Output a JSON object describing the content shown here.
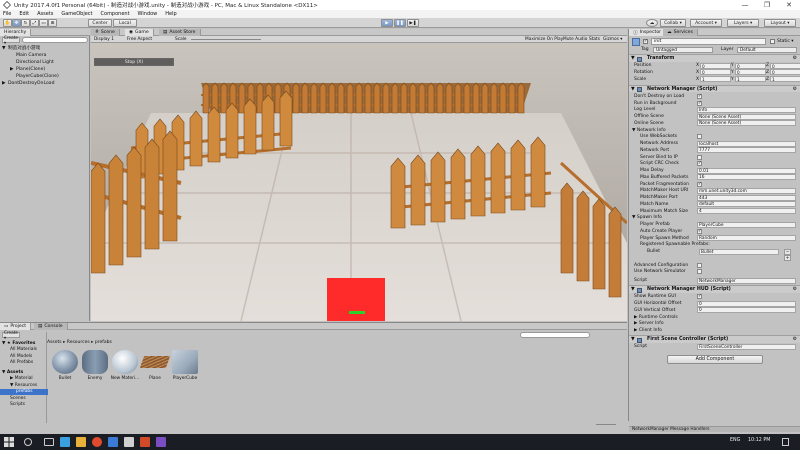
{
  "window": {
    "title": "Unity 2017.4.0f1 Personal (64bit) - 制造对战小游戏.unity - 制造对战小游戏 - PC, Mac & Linux Standalone <DX11>",
    "minimize": "—",
    "maximize": "❐",
    "close": "✕"
  },
  "menubar": [
    "File",
    "Edit",
    "Assets",
    "GameObject",
    "Component",
    "Window",
    "Help"
  ],
  "toolbar": {
    "pivot": "Center",
    "space": "Local",
    "play": "▶",
    "pause": "❚❚",
    "step": "▶❚",
    "collab": "Collab ▾",
    "account": "Account ▾",
    "layers": "Layers ▾",
    "layout": "Layout ▾"
  },
  "hierarchy": {
    "tab": "Hierarchy",
    "create": "Create ▾",
    "items": [
      {
        "label": "制造对战小游戏",
        "indent": 0,
        "arrow": "▼"
      },
      {
        "label": "Main Camera",
        "indent": 1,
        "arrow": ""
      },
      {
        "label": "Directional Light",
        "indent": 1,
        "arrow": ""
      },
      {
        "label": "Plane(Clone)",
        "indent": 1,
        "arrow": "▶"
      },
      {
        "label": "PlayerCube(Clone)",
        "indent": 1,
        "arrow": ""
      },
      {
        "label": "DontDestroyOnLoad",
        "indent": 0,
        "arrow": "▶"
      }
    ]
  },
  "gameview": {
    "tabs": [
      "Scene",
      "Game",
      "Asset Store"
    ],
    "display": "Display 1",
    "aspect": "Free Aspect",
    "scale_label": "Scale",
    "options": [
      "Maximize On Play",
      "Mute Audio",
      "Stats",
      "Gizmos ▾"
    ],
    "hud_button": "Stop (X)"
  },
  "inspector": {
    "tabs": [
      "Inspector",
      "Services"
    ],
    "object_name": "init",
    "static_label": "Static ▾",
    "tag_label": "Tag",
    "tag_value": "Untagged",
    "layer_label": "Layer",
    "layer_value": "Default",
    "transform": {
      "header": "Transform",
      "rows": [
        {
          "label": "Position",
          "x": "0",
          "y": "0",
          "z": "0"
        },
        {
          "label": "Rotation",
          "x": "0",
          "y": "0",
          "z": "0"
        },
        {
          "label": "Scale",
          "x": "1",
          "y": "1",
          "z": "1"
        }
      ]
    },
    "network_manager": {
      "header": "Network Manager (Script)",
      "rows": [
        {
          "label": "Don't Destroy on Load",
          "type": "check",
          "value": "✓"
        },
        {
          "label": "Run in Background",
          "type": "check",
          "value": "✓"
        },
        {
          "label": "Log Level",
          "type": "field",
          "value": "Info"
        },
        {
          "label": "Offline Scene",
          "type": "field",
          "value": "None (Scene Asset)"
        },
        {
          "label": "Online Scene",
          "type": "field",
          "value": "None (Scene Asset)"
        },
        {
          "label": "▼ Network Info",
          "type": "section",
          "value": ""
        },
        {
          "label": "Use WebSockets",
          "type": "check",
          "value": ""
        },
        {
          "label": "Network Address",
          "type": "field",
          "value": "localhost"
        },
        {
          "label": "Network Port",
          "type": "field",
          "value": "7777"
        },
        {
          "label": "Server Bind to IP",
          "type": "check",
          "value": ""
        },
        {
          "label": "Script CRC Check",
          "type": "check",
          "value": "✓"
        },
        {
          "label": "Max Delay",
          "type": "field",
          "value": "0.01"
        },
        {
          "label": "Max Buffered Packets",
          "type": "field",
          "value": "16"
        },
        {
          "label": "Packet Fragmentation",
          "type": "check",
          "value": "✓"
        },
        {
          "label": "MatchMaker Host URI",
          "type": "field",
          "value": "mm.unet.unity3d.com"
        },
        {
          "label": "MatchMaker Port",
          "type": "field",
          "value": "443"
        },
        {
          "label": "Match Name",
          "type": "field",
          "value": "default"
        },
        {
          "label": "Maximum Match Size",
          "type": "field",
          "value": "4"
        },
        {
          "label": "▼ Spawn Info",
          "type": "section",
          "value": ""
        },
        {
          "label": "Player Prefab",
          "type": "field",
          "value": "PlayerCube"
        },
        {
          "label": "Auto Create Player",
          "type": "check",
          "value": "✓"
        },
        {
          "label": "Player Spawn Method",
          "type": "field",
          "value": "Random"
        },
        {
          "label": "Registered Spawnable Prefabs:",
          "type": "plain",
          "value": ""
        }
      ],
      "spawn_list": {
        "label": "Bullet",
        "value": "Bullet"
      },
      "advanced_config": "Advanced Configuration",
      "use_simulator": "Use Network Simulator",
      "script_label": "Script",
      "script_value": "NetworkManager"
    },
    "hud": {
      "header": "Network Manager HUD (Script)",
      "rows": [
        {
          "label": "Show Runtime GUI",
          "type": "check",
          "value": "✓"
        },
        {
          "label": "GUI Horizontal Offset",
          "type": "field",
          "value": "0"
        },
        {
          "label": "GUI Vertical Offset",
          "type": "field",
          "value": "0"
        }
      ],
      "runtime_controls": "▶ Runtime Controls",
      "server_info": "▶ Server Info",
      "client_info": "▶ Client Info"
    },
    "first_scene": {
      "header": "First Scene Controller (Script)",
      "script_label": "Script",
      "script_value": "FirstSceneController"
    },
    "add_component": "Add Component",
    "footer": "NetworkManager Message Handlers"
  },
  "project": {
    "tabs": [
      "Project",
      "Console"
    ],
    "create": "Create ▾",
    "breadcrumb": "Assets ▸ Resources ▸ prefabs",
    "tree": [
      {
        "label": "▼ ★ Favorites",
        "bold": true
      },
      {
        "label": "All Materials",
        "bold": false
      },
      {
        "label": "All Models",
        "bold": false
      },
      {
        "label": "All Prefabs",
        "bold": false
      },
      {
        "label": "▼ Assets",
        "bold": true
      },
      {
        "label": "▶ Material",
        "bold": false
      },
      {
        "label": "▼ Resources",
        "bold": false
      },
      {
        "label": "prefabs",
        "bold": false
      },
      {
        "label": "Scenes",
        "bold": false
      },
      {
        "label": "Scripts",
        "bold": false
      }
    ],
    "assets": [
      {
        "name": "Bullet",
        "color": "#7f92a8"
      },
      {
        "name": "Enemy",
        "color": "#8a9eb3"
      },
      {
        "name": "New Materi...",
        "color": "#b9c6d3"
      },
      {
        "name": "Plane",
        "color": "#8a5a36"
      },
      {
        "name": "PlayerCube",
        "color": "#9aaabb"
      }
    ]
  },
  "taskbar": {
    "time": "10:12 PM",
    "lang": "ENG"
  },
  "colors": {
    "player_cube": "#ff2a2a",
    "fence": "#c07a30",
    "floor": "#d9d4cf",
    "sky": "#b9b3aa"
  }
}
